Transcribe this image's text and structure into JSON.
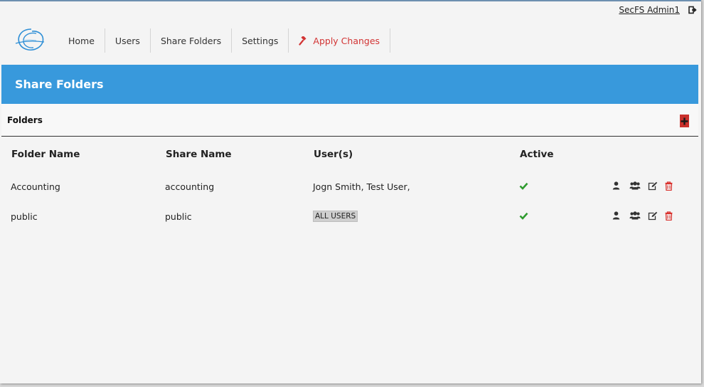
{
  "user": {
    "name": "SecFS Admin1",
    "logout_icon": "sign-out-icon"
  },
  "nav": {
    "logo_icon": "secfs-logo-icon",
    "items": [
      {
        "label": "Home"
      },
      {
        "label": "Users"
      },
      {
        "label": "Share Folders"
      },
      {
        "label": "Settings"
      },
      {
        "label": "Apply Changes",
        "icon": "gavel-icon",
        "color": "#d23434"
      }
    ]
  },
  "page": {
    "title": "Share Folders",
    "header_color": "#3899dc"
  },
  "section": {
    "label": "Folders",
    "add_icon": "plus-icon",
    "add_color": "#c9302c"
  },
  "table": {
    "headers": {
      "folder": "Folder Name",
      "share": "Share Name",
      "users": "User(s)",
      "active": "Active"
    },
    "rows": [
      {
        "folder": "Accounting",
        "share": "accounting",
        "users": "Jogn Smith, Test User,",
        "users_badge": "",
        "active": true
      },
      {
        "folder": "public",
        "share": "public",
        "users": "",
        "users_badge": "ALL USERS",
        "active": true
      }
    ],
    "row_action_icons": [
      "user-icon",
      "users-icon",
      "edit-icon",
      "trash-icon"
    ],
    "active_color": "#2e9b2e",
    "delete_color": "#d9322e"
  }
}
